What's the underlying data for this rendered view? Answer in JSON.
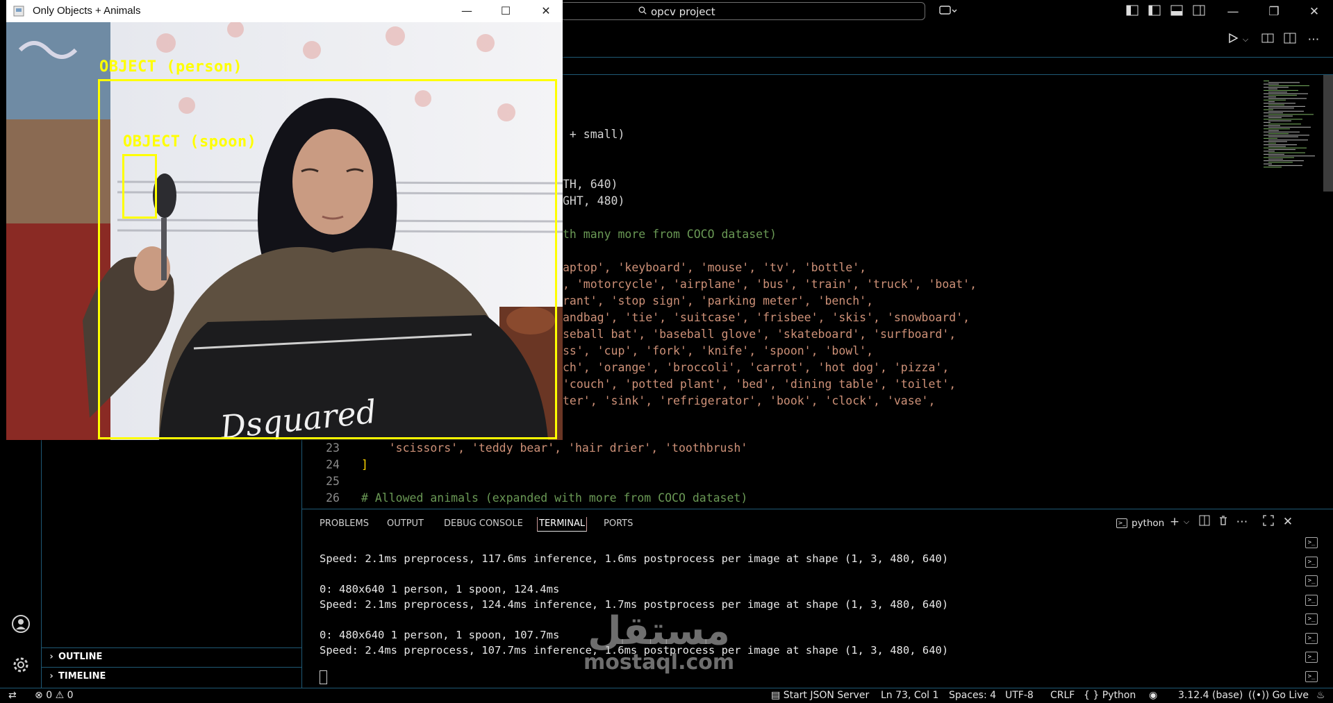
{
  "titlebar": {
    "search_text": "opcv project"
  },
  "cv_window": {
    "title": "Only Objects + Animals",
    "detections": [
      {
        "label": "OBJECT (person)"
      },
      {
        "label": "OBJECT (spoon)"
      }
    ],
    "hoodie_text": "Dsquared"
  },
  "sidebar": {
    "outline_label": "OUTLINE",
    "timeline_label": "TIMELINE"
  },
  "editor": {
    "visible_fragments": [
      {
        "text": " + small)",
        "kind": "plain"
      },
      {
        "text": "TH, 640)",
        "kind": "plain"
      },
      {
        "text": "GHT, 480)",
        "kind": "plain"
      },
      {
        "text": "th many more from COCO dataset)",
        "kind": "cmt"
      },
      {
        "text": "aptop', 'keyboard', 'mouse', 'tv', 'bottle',",
        "kind": "str"
      },
      {
        "text": ", 'motorcycle', 'airplane', 'bus', 'train', 'truck', 'boat',",
        "kind": "str"
      },
      {
        "text": "rant', 'stop sign', 'parking meter', 'bench',",
        "kind": "str"
      },
      {
        "text": "andbag', 'tie', 'suitcase', 'frisbee', 'skis', 'snowboard',",
        "kind": "str"
      },
      {
        "text": "seball bat', 'baseball glove', 'skateboard', 'surfboard',",
        "kind": "str"
      },
      {
        "text": "ss', 'cup', 'fork', 'knife', 'spoon', 'bowl',",
        "kind": "str"
      },
      {
        "text": "ch', 'orange', 'broccoli', 'carrot', 'hot dog', 'pizza',",
        "kind": "str"
      },
      {
        "text": "'couch', 'potted plant', 'bed', 'dining table', 'toilet',",
        "kind": "str"
      },
      {
        "text": "ter', 'sink', 'refrigerator', 'book', 'clock', 'vase',",
        "kind": "str"
      }
    ],
    "full_lines": [
      {
        "number": "23",
        "text": "    'scissors', 'teddy bear', 'hair drier', 'toothbrush'",
        "kind": "str"
      },
      {
        "number": "24",
        "text": "]",
        "kind": "brk"
      },
      {
        "number": "25",
        "text": "",
        "kind": "plain"
      },
      {
        "number": "26",
        "text": "# Allowed animals (expanded with more from COCO dataset)",
        "kind": "cmt"
      }
    ]
  },
  "panel": {
    "tabs": [
      "PROBLEMS",
      "OUTPUT",
      "DEBUG CONSOLE",
      "TERMINAL",
      "PORTS"
    ],
    "active_tab": "TERMINAL",
    "terminal_name": "python",
    "terminal_lines": [
      "Speed: 2.1ms preprocess, 117.6ms inference, 1.6ms postprocess per image at shape (1, 3, 480, 640)",
      "",
      "0: 480x640 1 person, 1 spoon, 124.4ms",
      "Speed: 2.1ms preprocess, 124.4ms inference, 1.7ms postprocess per image at shape (1, 3, 480, 640)",
      "",
      "0: 480x640 1 person, 1 spoon, 107.7ms",
      "Speed: 2.4ms preprocess, 107.7ms inference, 1.6ms postprocess per image at shape (1, 3, 480, 640)"
    ]
  },
  "statusbar": {
    "errors": "0",
    "warnings": "0",
    "json_server": "Start JSON Server",
    "position": "Ln 73, Col 1",
    "spaces": "Spaces: 4",
    "encoding": "UTF-8",
    "eol": "CRLF",
    "language": "Python",
    "interpreter": "3.12.4 (base)",
    "go_live": "Go Live"
  },
  "watermark": {
    "arabic": "مستقل",
    "latin": "mostaql.com"
  },
  "colors": {
    "detection": "#ffff00",
    "string": "#ce9178",
    "comment": "#6a9955",
    "border": "#1f5a76"
  }
}
